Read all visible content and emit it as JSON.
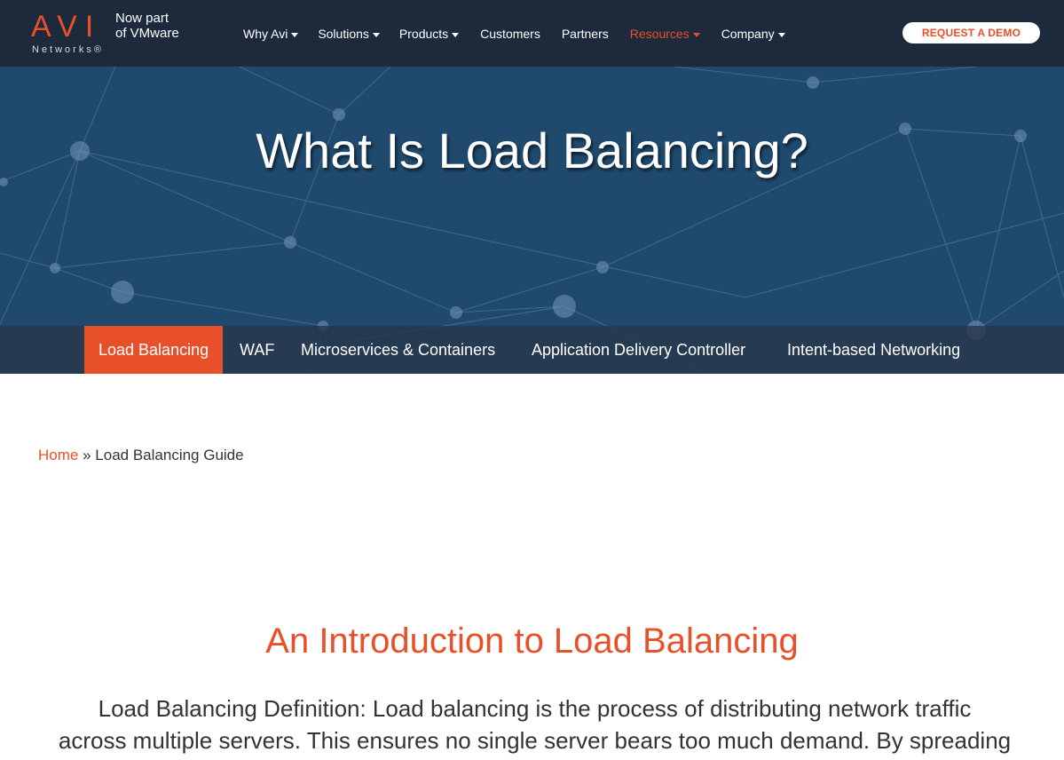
{
  "brand": {
    "logo_mark": "AVI",
    "logo_sub": "Networks®",
    "tag_line1": "Now part",
    "tag_line2": "of VMware"
  },
  "nav": {
    "items": [
      {
        "label": "Why Avi",
        "has_dropdown": true,
        "active": false
      },
      {
        "label": "Solutions",
        "has_dropdown": true,
        "active": false
      },
      {
        "label": "Products",
        "has_dropdown": true,
        "active": false
      },
      {
        "label": "Customers",
        "has_dropdown": false,
        "active": false
      },
      {
        "label": "Partners",
        "has_dropdown": false,
        "active": false
      },
      {
        "label": "Resources",
        "has_dropdown": true,
        "active": true
      },
      {
        "label": "Company",
        "has_dropdown": true,
        "active": false
      }
    ],
    "demo_label": "REQUEST A DEMO"
  },
  "hero": {
    "title": "What Is Load Balancing?"
  },
  "subnav": {
    "items": [
      {
        "label": "Load Balancing",
        "active": true
      },
      {
        "label": "WAF",
        "active": false
      },
      {
        "label": "Microservices & Containers",
        "active": false
      },
      {
        "label": "Application Delivery Controller",
        "active": false
      },
      {
        "label": "Intent-based Networking",
        "active": false
      }
    ]
  },
  "breadcrumb": {
    "home": "Home",
    "separator": "»",
    "current": "Load Balancing Guide"
  },
  "content": {
    "heading": "An Introduction to Load Balancing",
    "paragraph_line1": "Load Balancing Definition: Load balancing is the process of distributing network traffic",
    "paragraph_line2": "across multiple servers. This ensures no single server bears too much demand. By spreading"
  },
  "colors": {
    "accent": "#e8502a",
    "topbar": "#1d2a3c",
    "hero": "#1f4a6e"
  }
}
